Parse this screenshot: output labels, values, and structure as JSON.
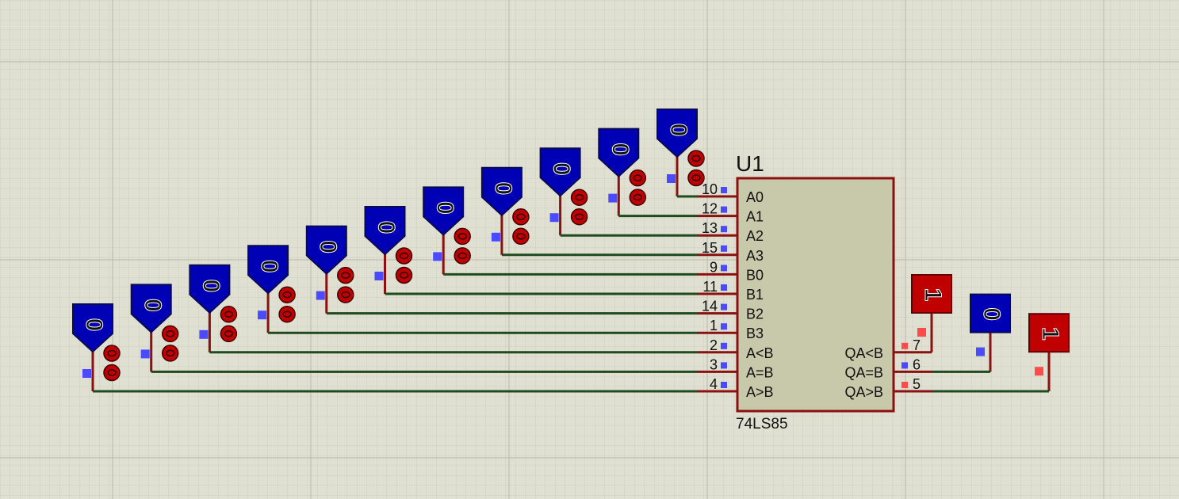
{
  "chip": {
    "ref": "U1",
    "part": "74LS85",
    "pins": [
      {
        "num": "10",
        "name": "A0"
      },
      {
        "num": "12",
        "name": "A1"
      },
      {
        "num": "13",
        "name": "A2"
      },
      {
        "num": "15",
        "name": "A3"
      },
      {
        "num": "9",
        "name": "B0"
      },
      {
        "num": "11",
        "name": "B1"
      },
      {
        "num": "14",
        "name": "B2"
      },
      {
        "num": "1",
        "name": "B3"
      },
      {
        "num": "2",
        "name": "A<B"
      },
      {
        "num": "3",
        "name": "A=B"
      },
      {
        "num": "4",
        "name": "A>B"
      }
    ],
    "outputs": [
      {
        "num": "7",
        "name": "QA<B",
        "state": "1"
      },
      {
        "num": "6",
        "name": "QA=B",
        "state": "0"
      },
      {
        "num": "5",
        "name": "QA>B",
        "state": "1"
      }
    ]
  },
  "inputs": [
    {
      "value": "0",
      "pin": "A>B"
    },
    {
      "value": "0",
      "pin": "A=B"
    },
    {
      "value": "0",
      "pin": "A<B"
    },
    {
      "value": "0",
      "pin": "B3"
    },
    {
      "value": "0",
      "pin": "B2"
    },
    {
      "value": "0",
      "pin": "B1"
    },
    {
      "value": "0",
      "pin": "B0"
    },
    {
      "value": "0",
      "pin": "A3"
    },
    {
      "value": "0",
      "pin": "A2"
    },
    {
      "value": "0",
      "pin": "A1"
    },
    {
      "value": "0",
      "pin": "A0"
    }
  ],
  "colors": {
    "background": "#e0e0d2",
    "grid_minor": "#cfcfbe",
    "grid_major": "#b9b9a6",
    "wire_low": "#1e4a1e",
    "wire_leg": "#8b1010",
    "logic_low_fill": "#0000b4",
    "logic_high_fill": "#c00000",
    "chip_body": "#c8c8aa",
    "chip_border": "#8b1010",
    "pin_low_marker": "#4a4aff",
    "pin_high_marker": "#ff4a4a"
  }
}
